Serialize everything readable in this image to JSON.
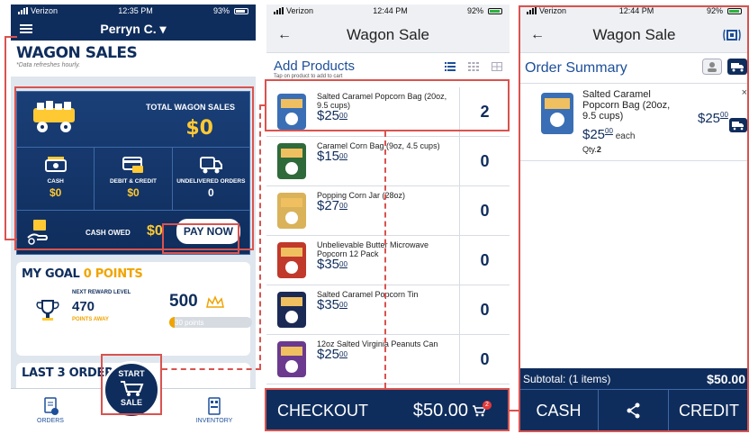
{
  "status_p1": {
    "carrier": "Verizon",
    "time": "12:35 PM",
    "battery": "93%"
  },
  "status_p2": {
    "carrier": "Verizon",
    "time": "12:44 PM",
    "battery": "92%"
  },
  "status_p3": {
    "carrier": "Verizon",
    "time": "12:44 PM",
    "battery": "92%"
  },
  "dashboard": {
    "user_name": "Perryn C. ▾",
    "title": "WAGON SALES",
    "note": "*Data refreshes hourly.",
    "total_label": "TOTAL WAGON SALES",
    "total_value": "$0",
    "cash_label": "CASH",
    "cash_value": "$0",
    "debit_label": "DEBIT & CREDIT",
    "debit_value": "$0",
    "undelivered_label": "UNDELIVERED ORDERS",
    "undelivered_value": "0",
    "cash_owed_label": "CASH OWED",
    "cash_owed_value": "$0",
    "pay_now": "PAY NOW",
    "goal_title_a": "MY GOAL ",
    "goal_title_b": "0 POINTS",
    "next_reward_label": "NEXT REWARD LEVEL",
    "next_reward_value": "470",
    "points_away": "POINTS AWAY",
    "goal_value": "500",
    "progress_label": "30 points",
    "progress_fraction": 0.06,
    "last_orders_title": "LAST 3 ORDERS",
    "start_line1": "START",
    "start_line2": "SALE",
    "tab_orders": "ORDERS",
    "tab_inventory": "INVENTORY"
  },
  "wagon_sale": {
    "back_icon": "arrow-left-icon",
    "title": "Wagon Sale",
    "add_products": "Add Products",
    "add_hint": "Tap on product to add to cart",
    "products": [
      {
        "name": "Salted Caramel Popcorn Bag (20oz, 9.5 cups)",
        "price": "$25",
        "cents": "00",
        "qty": "2",
        "color": "#3a6fb5"
      },
      {
        "name": "Caramel Corn Bag (9oz, 4.5 cups)",
        "price": "$15",
        "cents": "00",
        "qty": "0",
        "color": "#2f6a3a"
      },
      {
        "name": "Popping Corn Jar (28oz)",
        "price": "$27",
        "cents": "00",
        "qty": "0",
        "color": "#d9b25a"
      },
      {
        "name": "Unbelievable Butter Microwave Popcorn 12 Pack",
        "price": "$35",
        "cents": "00",
        "qty": "0",
        "color": "#c0392b"
      },
      {
        "name": "Salted Caramel Popcorn Tin",
        "price": "$35",
        "cents": "00",
        "qty": "0",
        "color": "#1b2a55"
      },
      {
        "name": "12oz Salted Virginia Peanuts Can",
        "price": "$25",
        "cents": "00",
        "qty": "0",
        "color": "#6b3a8e"
      }
    ],
    "checkout_label": "CHECKOUT",
    "checkout_total": "$50.00",
    "cart_badge": "2"
  },
  "order_summary": {
    "title": "Wagon Sale",
    "summary_title": "Order Summary",
    "item_name": "Salted Caramel Popcorn Bag (20oz, 9.5 cups)",
    "item_price": "$25",
    "item_cents": "00",
    "each": " each",
    "qty_label": "Qty.",
    "qty_value": "2",
    "line_total": "$25",
    "line_cents": "00",
    "remove": "×",
    "subtotal_label": "Subtotal: (1 items)",
    "subtotal_value": "$50.00",
    "cash": "CASH",
    "credit": "CREDIT"
  },
  "colors": {
    "navy": "#0f2d5c",
    "gold": "#ffc933",
    "accent": "#d9534f",
    "link_blue": "#1d4f9a"
  }
}
